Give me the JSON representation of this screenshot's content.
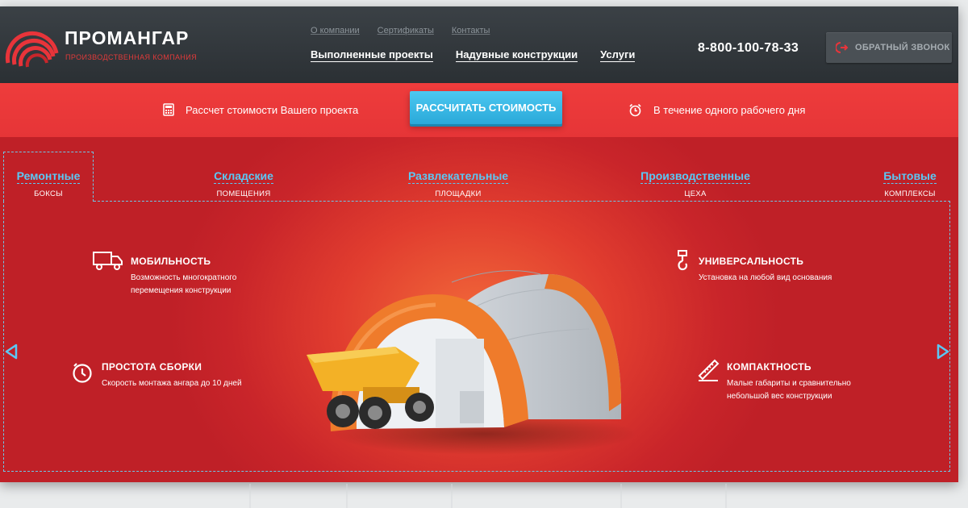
{
  "header": {
    "logo_title": "ПРОМАНГАР",
    "logo_subtitle": "ПРОИЗВОДСТВЕННАЯ КОМПАНИЯ",
    "top_links": [
      "О компании",
      "Сертификаты",
      "Контакты"
    ],
    "main_links": [
      "Выполненные проекты",
      "Надувные конструкции",
      "Услуги"
    ],
    "phone": "8-800-100-78-33",
    "callback_label": "ОБРАТНЫЙ ЗВОНОК"
  },
  "bar": {
    "left_text": "Рассчет стоимости Вашего проекта",
    "cta_label": "РАССЧИТАТЬ СТОИМОСТЬ",
    "right_text": "В течение одного рабочего дня"
  },
  "categories": [
    {
      "title": "Ремонтные",
      "subtitle": "БОКСЫ"
    },
    {
      "title": "Складские",
      "subtitle": "ПОМЕЩЕНИЯ"
    },
    {
      "title": "Развлекательные",
      "subtitle": "ПЛОЩАДКИ"
    },
    {
      "title": "Производственные",
      "subtitle": "ЦЕХА"
    },
    {
      "title": "Бытовые",
      "subtitle": "КОМПЛЕКСЫ"
    }
  ],
  "features": {
    "mobility": {
      "title": "МОБИЛЬНОСТЬ",
      "line1": "Возможность многократного",
      "line2": "перемещения конструкции"
    },
    "universality": {
      "title": "УНИВЕРСАЛЬНОСТЬ",
      "line1": "Установка на любой вид основания"
    },
    "simplicity": {
      "title": "ПРОСТОТА СБОРКИ",
      "line1": "Скорость монтажа ангара до 10 дней"
    },
    "compactness": {
      "title": "КОМПАКТНОСТЬ",
      "line1": "Малые габариты и сравнительно",
      "line2": "небольшой вес конструкции"
    }
  },
  "icons": {
    "logo": "arches-logo-icon",
    "callback": "phone-arrow-icon",
    "calculator": "calculator-icon",
    "clock": "alarm-clock-icon",
    "truck": "truck-icon",
    "hook": "crane-hook-icon",
    "timer": "timer-icon",
    "ruler": "ruler-pencil-icon",
    "prev": "arrow-left-icon",
    "next": "arrow-right-icon"
  },
  "colors": {
    "header_bg": "#2f3438",
    "brand_red": "#e63537",
    "cta_blue": "#2aa9d9",
    "link_blue": "#5bc8f5",
    "hangar_orange": "#ee7a2a"
  }
}
